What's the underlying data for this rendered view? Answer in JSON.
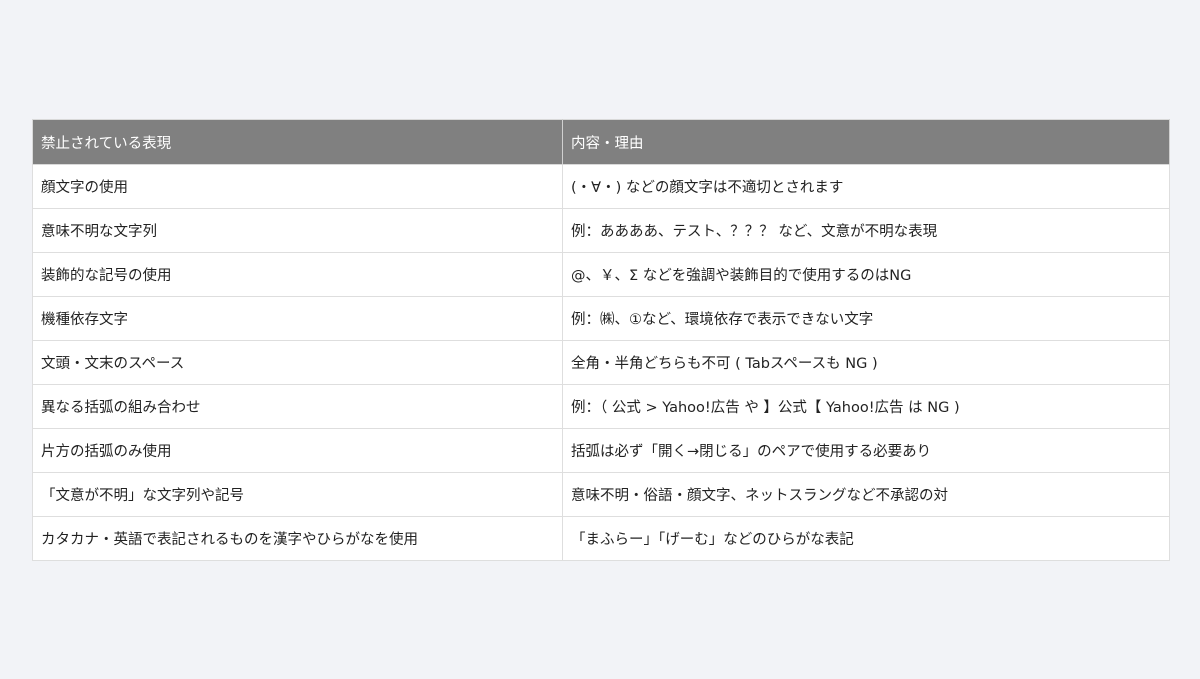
{
  "table": {
    "headers": [
      "禁止されている表現",
      "内容・理由"
    ],
    "rows": [
      [
        "顔文字の使用",
        "(・∀・) などの顔文字は不適切とされます"
      ],
      [
        "意味不明な文字列",
        "例：ああああ、テスト、？？？ など、文意が不明な表現"
      ],
      [
        "装飾的な記号の使用",
        "@、￥、Σ などを強調や装飾目的で使用するのはNG"
      ],
      [
        "機種依存文字",
        "例：㈱、①など、環境依存で表示できない文字"
      ],
      [
        "文頭・文末のスペース",
        "全角・半角どちらも不可 ( Tabスペースも NG )"
      ],
      [
        "異なる括弧の組み合わせ",
        "例：（ 公式 > Yahoo!広告 や 】公式【 Yahoo!広告 は NG )"
      ],
      [
        "片方の括弧のみ使用",
        "括弧は必ず「開く→閉じる」のペアで使用する必要あり"
      ],
      [
        "「文意が不明」な文字列や記号",
        "意味不明・俗語・顔文字、ネットスラングなど不承認の対"
      ],
      [
        "カタカナ・英語で表記されるものを漢字やひらがなを使用",
        "「まふらー」「げーむ」などのひらがな表記"
      ]
    ]
  }
}
